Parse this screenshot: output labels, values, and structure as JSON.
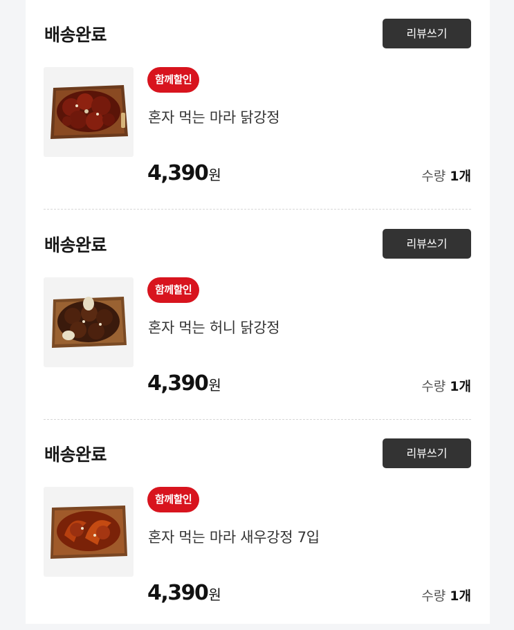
{
  "orders": [
    {
      "status": "배송완료",
      "review_label": "리뷰쓰기",
      "badge": "함께할인",
      "name": "혼자 먹는 마라 닭강정",
      "price": "4,390",
      "currency": "원",
      "qty_label": "수량",
      "qty_value": "1개",
      "image": "mara-chicken-photo"
    },
    {
      "status": "배송완료",
      "review_label": "리뷰쓰기",
      "badge": "함께할인",
      "name": "혼자 먹는 허니 닭강정",
      "price": "4,390",
      "currency": "원",
      "qty_label": "수량",
      "qty_value": "1개",
      "image": "honey-chicken-photo"
    },
    {
      "status": "배송완료",
      "review_label": "리뷰쓰기",
      "badge": "함께할인",
      "name": "혼자 먹는 마라 새우강정 7입",
      "price": "4,390",
      "currency": "원",
      "qty_label": "수량",
      "qty_value": "1개",
      "image": "mara-shrimp-photo"
    }
  ],
  "colors": {
    "badge": "#d8141e",
    "button": "#333333",
    "background": "#f4f5f7",
    "card": "#ffffff"
  }
}
